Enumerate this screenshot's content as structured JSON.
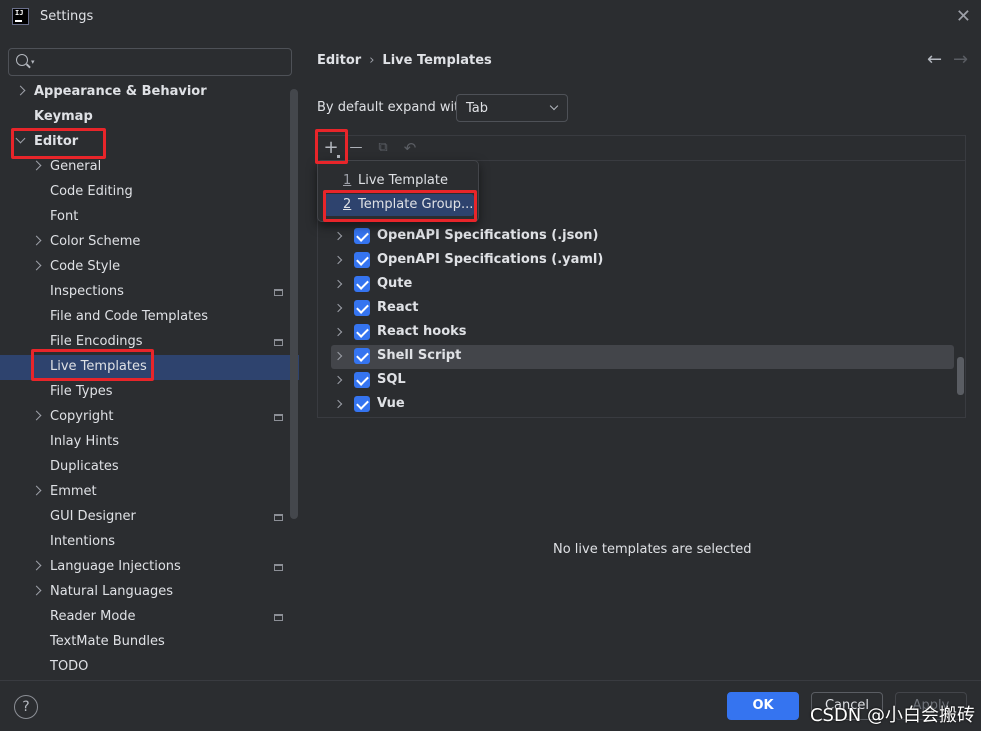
{
  "window": {
    "title": "Settings",
    "logo_text": "IJ"
  },
  "search": {
    "placeholder": ""
  },
  "sidebar": {
    "items": [
      {
        "label": "Appearance & Behavior",
        "bold": true,
        "level": 0,
        "chevron": "right"
      },
      {
        "label": "Keymap",
        "bold": true,
        "level": 0,
        "chevron": "none"
      },
      {
        "label": "Editor",
        "bold": true,
        "level": 0,
        "chevron": "down"
      },
      {
        "label": "General",
        "level": 1,
        "chevron": "right"
      },
      {
        "label": "Code Editing",
        "level": 1,
        "chevron": "none"
      },
      {
        "label": "Font",
        "level": 1,
        "chevron": "none"
      },
      {
        "label": "Color Scheme",
        "level": 1,
        "chevron": "right"
      },
      {
        "label": "Code Style",
        "level": 1,
        "chevron": "right"
      },
      {
        "label": "Inspections",
        "level": 1,
        "chevron": "none",
        "project_icon": true
      },
      {
        "label": "File and Code Templates",
        "level": 1,
        "chevron": "none"
      },
      {
        "label": "File Encodings",
        "level": 1,
        "chevron": "none",
        "project_icon": true
      },
      {
        "label": "Live Templates",
        "level": 1,
        "chevron": "none",
        "selected": true
      },
      {
        "label": "File Types",
        "level": 1,
        "chevron": "none"
      },
      {
        "label": "Copyright",
        "level": 1,
        "chevron": "right",
        "project_icon": true
      },
      {
        "label": "Inlay Hints",
        "level": 1,
        "chevron": "none"
      },
      {
        "label": "Duplicates",
        "level": 1,
        "chevron": "none"
      },
      {
        "label": "Emmet",
        "level": 1,
        "chevron": "right"
      },
      {
        "label": "GUI Designer",
        "level": 1,
        "chevron": "none",
        "project_icon": true
      },
      {
        "label": "Intentions",
        "level": 1,
        "chevron": "none"
      },
      {
        "label": "Language Injections",
        "level": 1,
        "chevron": "right",
        "project_icon": true
      },
      {
        "label": "Natural Languages",
        "level": 1,
        "chevron": "right"
      },
      {
        "label": "Reader Mode",
        "level": 1,
        "chevron": "none",
        "project_icon": true
      },
      {
        "label": "TextMate Bundles",
        "level": 1,
        "chevron": "none"
      },
      {
        "label": "TODO",
        "level": 1,
        "chevron": "none"
      }
    ]
  },
  "breadcrumb": {
    "parent": "Editor",
    "separator": "›",
    "current": "Live Templates"
  },
  "expand": {
    "label": "By default expand with",
    "value": "Tab"
  },
  "toolbar": {
    "add": "+",
    "remove": "—",
    "copy": "⧉",
    "restore": "↶"
  },
  "popup": {
    "items": [
      {
        "num": "1",
        "label": "Live Template"
      },
      {
        "num": "2",
        "label": "Template Group..."
      }
    ]
  },
  "groups": [
    {
      "name": "OpenAPI Specifications (.json)",
      "checked": true
    },
    {
      "name": "OpenAPI Specifications (.yaml)",
      "checked": true
    },
    {
      "name": "Qute",
      "checked": true
    },
    {
      "name": "React",
      "checked": true
    },
    {
      "name": "React hooks",
      "checked": true
    },
    {
      "name": "Shell Script",
      "checked": true,
      "highlighted": true
    },
    {
      "name": "SQL",
      "checked": true
    },
    {
      "name": "Vue",
      "checked": true
    }
  ],
  "empty_message": "No live templates are selected",
  "footer": {
    "help": "?",
    "ok": "OK",
    "cancel": "Cancel",
    "apply": "Apply"
  },
  "watermark": "CSDN @小白会搬砖",
  "colors": {
    "accent": "#3574f0",
    "selection": "#2e436e",
    "annotation": "#e8252a",
    "background": "#2b2d30"
  }
}
